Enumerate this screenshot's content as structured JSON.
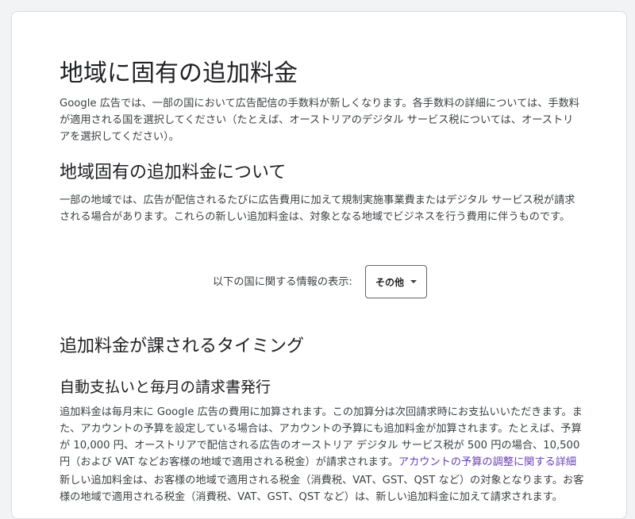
{
  "page": {
    "title": "地域に固有の追加料金",
    "intro_lines": [
      "Google 広告では、一部の国において広告配信の手数料が新しくなります。各手数料の詳細については、手数料",
      "が適用される国を選択してください（たとえば、オーストリアのデジタル サービス税については、オーストリ",
      "アを選択してください）。"
    ],
    "about": {
      "heading": "地域固有の追加料金について",
      "lines": [
        "一部の地域では、広告が配信されるたびに広告費用に加えて規制実施事業費またはデジタル サービス税が請求",
        "される場合があります。これらの新しい追加料金は、対象となる地域でビジネスを行う費用に伴うものです。"
      ]
    },
    "country_selector": {
      "label": "以下の国に関する情報の表示:",
      "selected": "その他",
      "caret_icon": "chevron-down-icon"
    },
    "timing": {
      "heading": "追加料金が課されるタイミング",
      "subheading": "自動支払いと毎月の請求書発行",
      "para1_lines": [
        "追加料金は毎月末に Google 広告の費用に加算されます。この加算分は次回請求時にお支払いいただきます。ま",
        "た、アカウントの予算を設定している場合は、アカウントの予算にも追加料金が加算されます。たとえば、予算",
        "が 10,000 円、オーストリアで配信される広告のオーストリア デジタル サービス税が 500 円の場合、10,500",
        "円（および VAT などお客様の地域で適用される税金）が請求されます。"
      ],
      "para1_link": "アカウントの予算の調整に関する詳細",
      "para2_lines": [
        "新しい追加料金は、お客様の地域で適用される税金（消費税、VAT、GST、QST など）の対象となります。お客",
        "様の地域で適用される税金（消費税、VAT、GST、QST など）は、新しい追加料金に加えて請求されます。"
      ]
    },
    "link_color": "#6a3fb5"
  }
}
